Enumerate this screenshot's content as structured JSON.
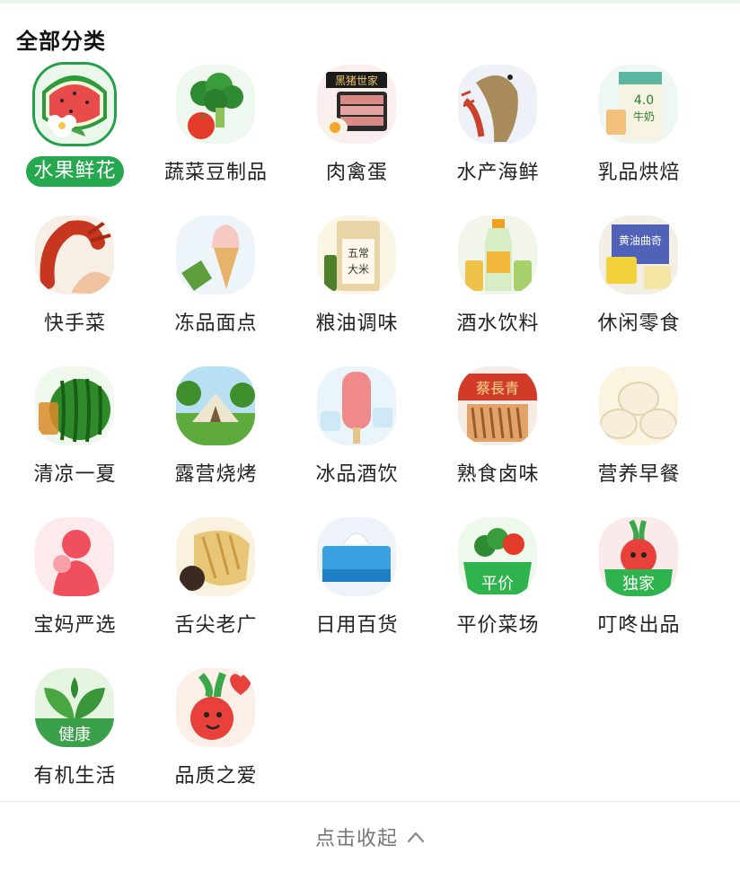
{
  "header": {
    "title": "全部分类"
  },
  "categories": [
    {
      "label": "水果鲜花",
      "icon": "watermelon-flower-icon",
      "active": true
    },
    {
      "label": "蔬菜豆制品",
      "icon": "broccoli-icon"
    },
    {
      "label": "肉禽蛋",
      "icon": "meat-egg-icon"
    },
    {
      "label": "水产海鲜",
      "icon": "fish-lobster-icon"
    },
    {
      "label": "乳品烘焙",
      "icon": "milk-bread-icon"
    },
    {
      "label": "快手菜",
      "icon": "crawfish-icon"
    },
    {
      "label": "冻品面点",
      "icon": "ice-cream-cone-icon"
    },
    {
      "label": "粮油调味",
      "icon": "rice-bag-icon"
    },
    {
      "label": "酒水饮料",
      "icon": "drinks-bottles-icon"
    },
    {
      "label": "休闲零食",
      "icon": "snacks-box-icon"
    },
    {
      "label": "清凉一夏",
      "icon": "watermelon-tea-icon"
    },
    {
      "label": "露营烧烤",
      "icon": "camping-tent-icon"
    },
    {
      "label": "冰品酒饮",
      "icon": "ice-pop-icon"
    },
    {
      "label": "熟食卤味",
      "icon": "braised-food-icon"
    },
    {
      "label": "营养早餐",
      "icon": "steamed-buns-icon"
    },
    {
      "label": "宝妈严选",
      "icon": "mother-baby-icon"
    },
    {
      "label": "舌尖老广",
      "icon": "roast-goose-icon"
    },
    {
      "label": "日用百货",
      "icon": "tissue-box-icon"
    },
    {
      "label": "平价菜场",
      "icon": "veg-basket-affordable-icon",
      "badge": "平价"
    },
    {
      "label": "叮咚出品",
      "icon": "radish-mascot-exclusive-icon",
      "badge": "独家"
    },
    {
      "label": "有机生活",
      "icon": "organic-leaf-icon",
      "badge": "健康"
    },
    {
      "label": "品质之爱",
      "icon": "radish-heart-icon"
    }
  ],
  "footer": {
    "collapse_label": "点击收起",
    "icon": "chevron-up-icon"
  },
  "colors": {
    "accent": "#26a84f",
    "active_border": "#22a04a",
    "title": "#111111",
    "label": "#222222",
    "footer_text": "#777777"
  }
}
